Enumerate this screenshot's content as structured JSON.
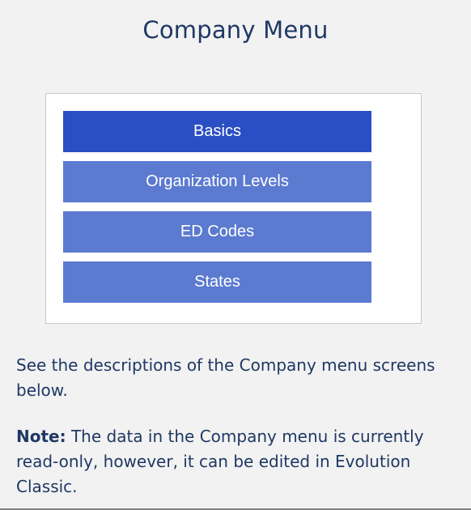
{
  "page": {
    "title": "Company Menu"
  },
  "menu": {
    "items": [
      {
        "label": "Basics",
        "state": "selected"
      },
      {
        "label": "Organization Levels",
        "state": "normal"
      },
      {
        "label": "ED Codes",
        "state": "normal"
      },
      {
        "label": "States",
        "state": "normal"
      }
    ],
    "colors": {
      "selected": "#2a4ec4",
      "normal": "#5b7ad0",
      "text": "#ffffff"
    }
  },
  "content": {
    "description": "See the descriptions of the Company menu screens below.",
    "note_label": "Note:",
    "note_text": " The data in the Company menu is currently read-only, however, it can be edited in Evolution Classic."
  }
}
